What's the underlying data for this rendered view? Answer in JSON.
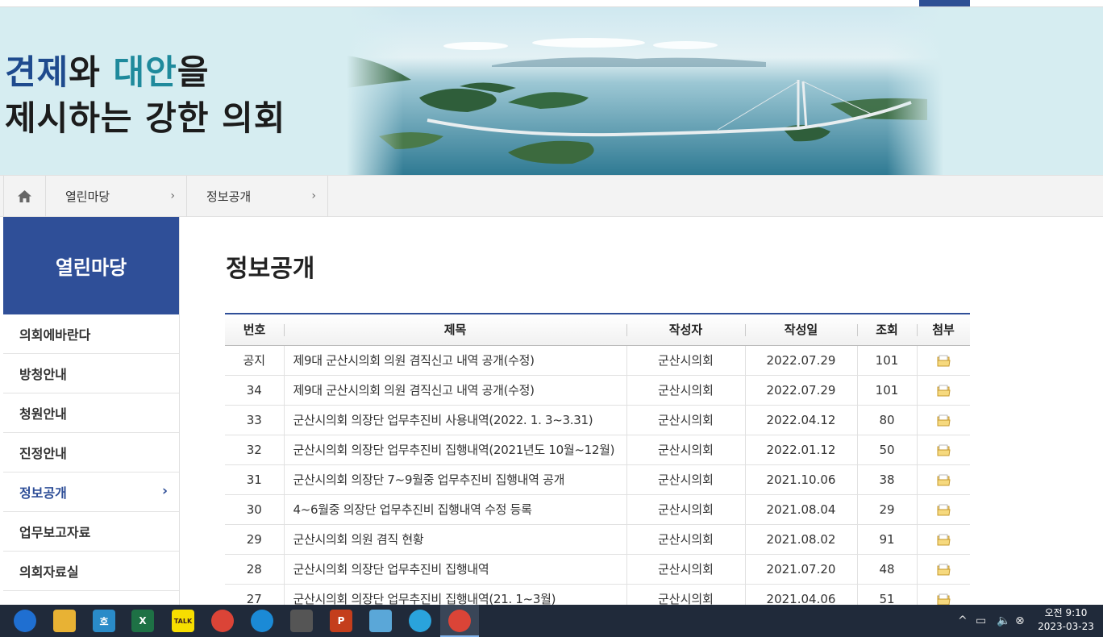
{
  "banner": {
    "slogan_l1_a": "견제",
    "slogan_l1_b": "와 ",
    "slogan_l1_c": "대안",
    "slogan_l1_d": "을",
    "slogan_l2": "제시하는 강한 의회"
  },
  "breadcrumb": {
    "items": [
      "열린마당",
      "정보공개"
    ],
    "chevron": "›"
  },
  "sidebar": {
    "title": "열린마당",
    "items": [
      {
        "label": "의회에바란다"
      },
      {
        "label": "방청안내"
      },
      {
        "label": "청원안내"
      },
      {
        "label": "진정안내"
      },
      {
        "label": "정보공개",
        "active": true
      },
      {
        "label": "업무보고자료"
      },
      {
        "label": "의회자료실"
      }
    ],
    "chevron": "›"
  },
  "main": {
    "title": "정보공개",
    "columns": [
      "번호",
      "제목",
      "작성자",
      "작성일",
      "조회",
      "첨부"
    ],
    "rows": [
      {
        "no": "공지",
        "title": "제9대 군산시의회 의원 겸직신고 내역 공개(수정)",
        "author": "군산시의회",
        "date": "2022.07.29",
        "views": "101",
        "attach": "file-icon"
      },
      {
        "no": "34",
        "title": "제9대 군산시의회 의원 겸직신고 내역 공개(수정)",
        "author": "군산시의회",
        "date": "2022.07.29",
        "views": "101",
        "attach": "file-icon"
      },
      {
        "no": "33",
        "title": "군산시의회 의장단 업무추진비 사용내역(2022. 1. 3~3.31)",
        "author": "군산시의회",
        "date": "2022.04.12",
        "views": "80",
        "attach": "file-icon"
      },
      {
        "no": "32",
        "title": "군산시의회 의장단 업무추진비 집행내역(2021년도 10월~12월)",
        "author": "군산시의회",
        "date": "2022.01.12",
        "views": "50",
        "attach": "file-icon"
      },
      {
        "no": "31",
        "title": "군산시의회 의장단 7~9월중 업무추진비 집행내역 공개",
        "author": "군산시의회",
        "date": "2021.10.06",
        "views": "38",
        "attach": "file-icon"
      },
      {
        "no": "30",
        "title": "4~6월중 의장단 업무추진비 집행내역 수정 등록",
        "author": "군산시의회",
        "date": "2021.08.04",
        "views": "29",
        "attach": "file-icon"
      },
      {
        "no": "29",
        "title": "군산시의회 의원 겸직 현황",
        "author": "군산시의회",
        "date": "2021.08.02",
        "views": "91",
        "attach": "file-icon"
      },
      {
        "no": "28",
        "title": "군산시의회 의장단 업무추진비 집행내역",
        "author": "군산시의회",
        "date": "2021.07.20",
        "views": "48",
        "attach": "file-icon"
      },
      {
        "no": "27",
        "title": "군산시의회 의장단 업무추진비 집행내역(21. 1~3월)",
        "author": "군산시의회",
        "date": "2021.04.06",
        "views": "51",
        "attach": "file-icon"
      }
    ]
  },
  "taskbar": {
    "apps": [
      {
        "name": "pin-app-icon",
        "glyph": "",
        "color": "#1f6fd1"
      },
      {
        "name": "file-explorer-icon",
        "glyph": "",
        "color": "#e8b234"
      },
      {
        "name": "hwp-icon",
        "glyph": "호",
        "color": "#2a8bc8"
      },
      {
        "name": "excel-icon",
        "glyph": "X",
        "color": "#1e7145"
      },
      {
        "name": "kakaotalk-icon",
        "glyph": "TALK",
        "color": "#f7de00"
      },
      {
        "name": "chrome-icon",
        "glyph": "",
        "color": "#db4437"
      },
      {
        "name": "edge-icon",
        "glyph": "",
        "color": "#1b8ad6"
      },
      {
        "name": "screen-capture-icon",
        "glyph": "",
        "color": "#555555"
      },
      {
        "name": "powerpoint-icon",
        "glyph": "P",
        "color": "#c43e1c"
      },
      {
        "name": "notepad-icon",
        "glyph": "",
        "color": "#5aa7d8"
      },
      {
        "name": "telegram-icon",
        "glyph": "",
        "color": "#2aa3dc"
      },
      {
        "name": "chrome-active-icon",
        "glyph": "",
        "color": "#db4437"
      }
    ],
    "tray": {
      "chevron": "^",
      "network": "▭",
      "volume": "🔈",
      "close": "⊗"
    },
    "clock_time": "오전 9:10",
    "clock_date": "2023-03-23"
  },
  "colors": {
    "navy": "#2f4f98",
    "slogan_navy": "#1f4b8e",
    "slogan_teal": "#1f8a9c",
    "banner_bg": "#d6edf1"
  }
}
